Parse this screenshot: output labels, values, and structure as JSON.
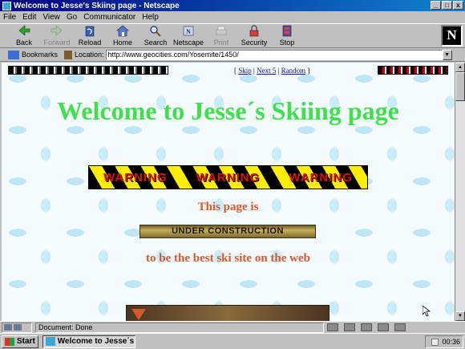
{
  "window": {
    "title": "Welcome to Jesse's Skiing page - Netscape",
    "buttons": [
      "_",
      "□",
      "x"
    ]
  },
  "menu": [
    "File",
    "Edit",
    "View",
    "Go",
    "Communicator",
    "Help"
  ],
  "toolbar": [
    {
      "label": "Back",
      "icon": "back-arrow-icon",
      "enabled": true
    },
    {
      "label": "Forward",
      "icon": "forward-arrow-icon",
      "enabled": false
    },
    {
      "label": "Reload",
      "icon": "reload-icon",
      "enabled": true
    },
    {
      "label": "Home",
      "icon": "home-icon",
      "enabled": true
    },
    {
      "label": "Search",
      "icon": "search-icon",
      "enabled": true
    },
    {
      "label": "Netscape",
      "icon": "netscape-icon",
      "enabled": true
    },
    {
      "label": "Print",
      "icon": "print-icon",
      "enabled": false
    },
    {
      "label": "Security",
      "icon": "security-icon",
      "enabled": true
    },
    {
      "label": "Stop",
      "icon": "stop-icon",
      "enabled": true
    }
  ],
  "logo": "N",
  "location": {
    "bookmarks_label": "Bookmarks",
    "location_label": "Location:",
    "url": "http://www.geocities.com/Yosemite/1450/"
  },
  "page": {
    "nav": {
      "open": "[",
      "skip": "Skip",
      "sep1": "|",
      "next": "Next 5",
      "sep2": "|",
      "random": "Random",
      "close": "]"
    },
    "heading": "Welcome to Jesse´s Skiing page",
    "warning": [
      "WARNING",
      "WARNING",
      "WARNING"
    ],
    "page_is": "This page is",
    "under_construction": "UNDER CONSTRUCTION",
    "best_text": "to be the best ski site on the web"
  },
  "status": {
    "text": "Document: Done"
  },
  "taskbar": {
    "start": "Start",
    "task": "Welcome to Jesse´s ...",
    "clock": "00:36"
  },
  "colors": {
    "heading": "#3fe04a",
    "body_text": "#d9572a",
    "warning_text": "#e01010",
    "title_bar": "#000080"
  }
}
